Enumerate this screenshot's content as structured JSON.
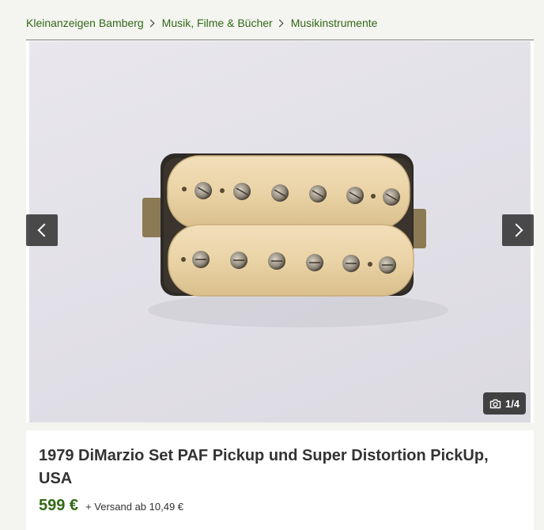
{
  "breadcrumb": {
    "items": [
      "Kleinanzeigen Bamberg",
      "Musik, Filme & Bücher",
      "Musikinstrumente"
    ]
  },
  "gallery": {
    "counter": "1/4",
    "icons": {
      "prev": "chevron-left-icon",
      "next": "chevron-right-icon",
      "counter": "camera-icon"
    }
  },
  "listing": {
    "title": "1979 DiMarzio Set PAF Pickup und Super Distortion PickUp, USA",
    "price": "599 €",
    "shipping": "+ Versand ab 10,49 €"
  },
  "colors": {
    "accent": "#326916",
    "background": "#f4f4f0"
  }
}
